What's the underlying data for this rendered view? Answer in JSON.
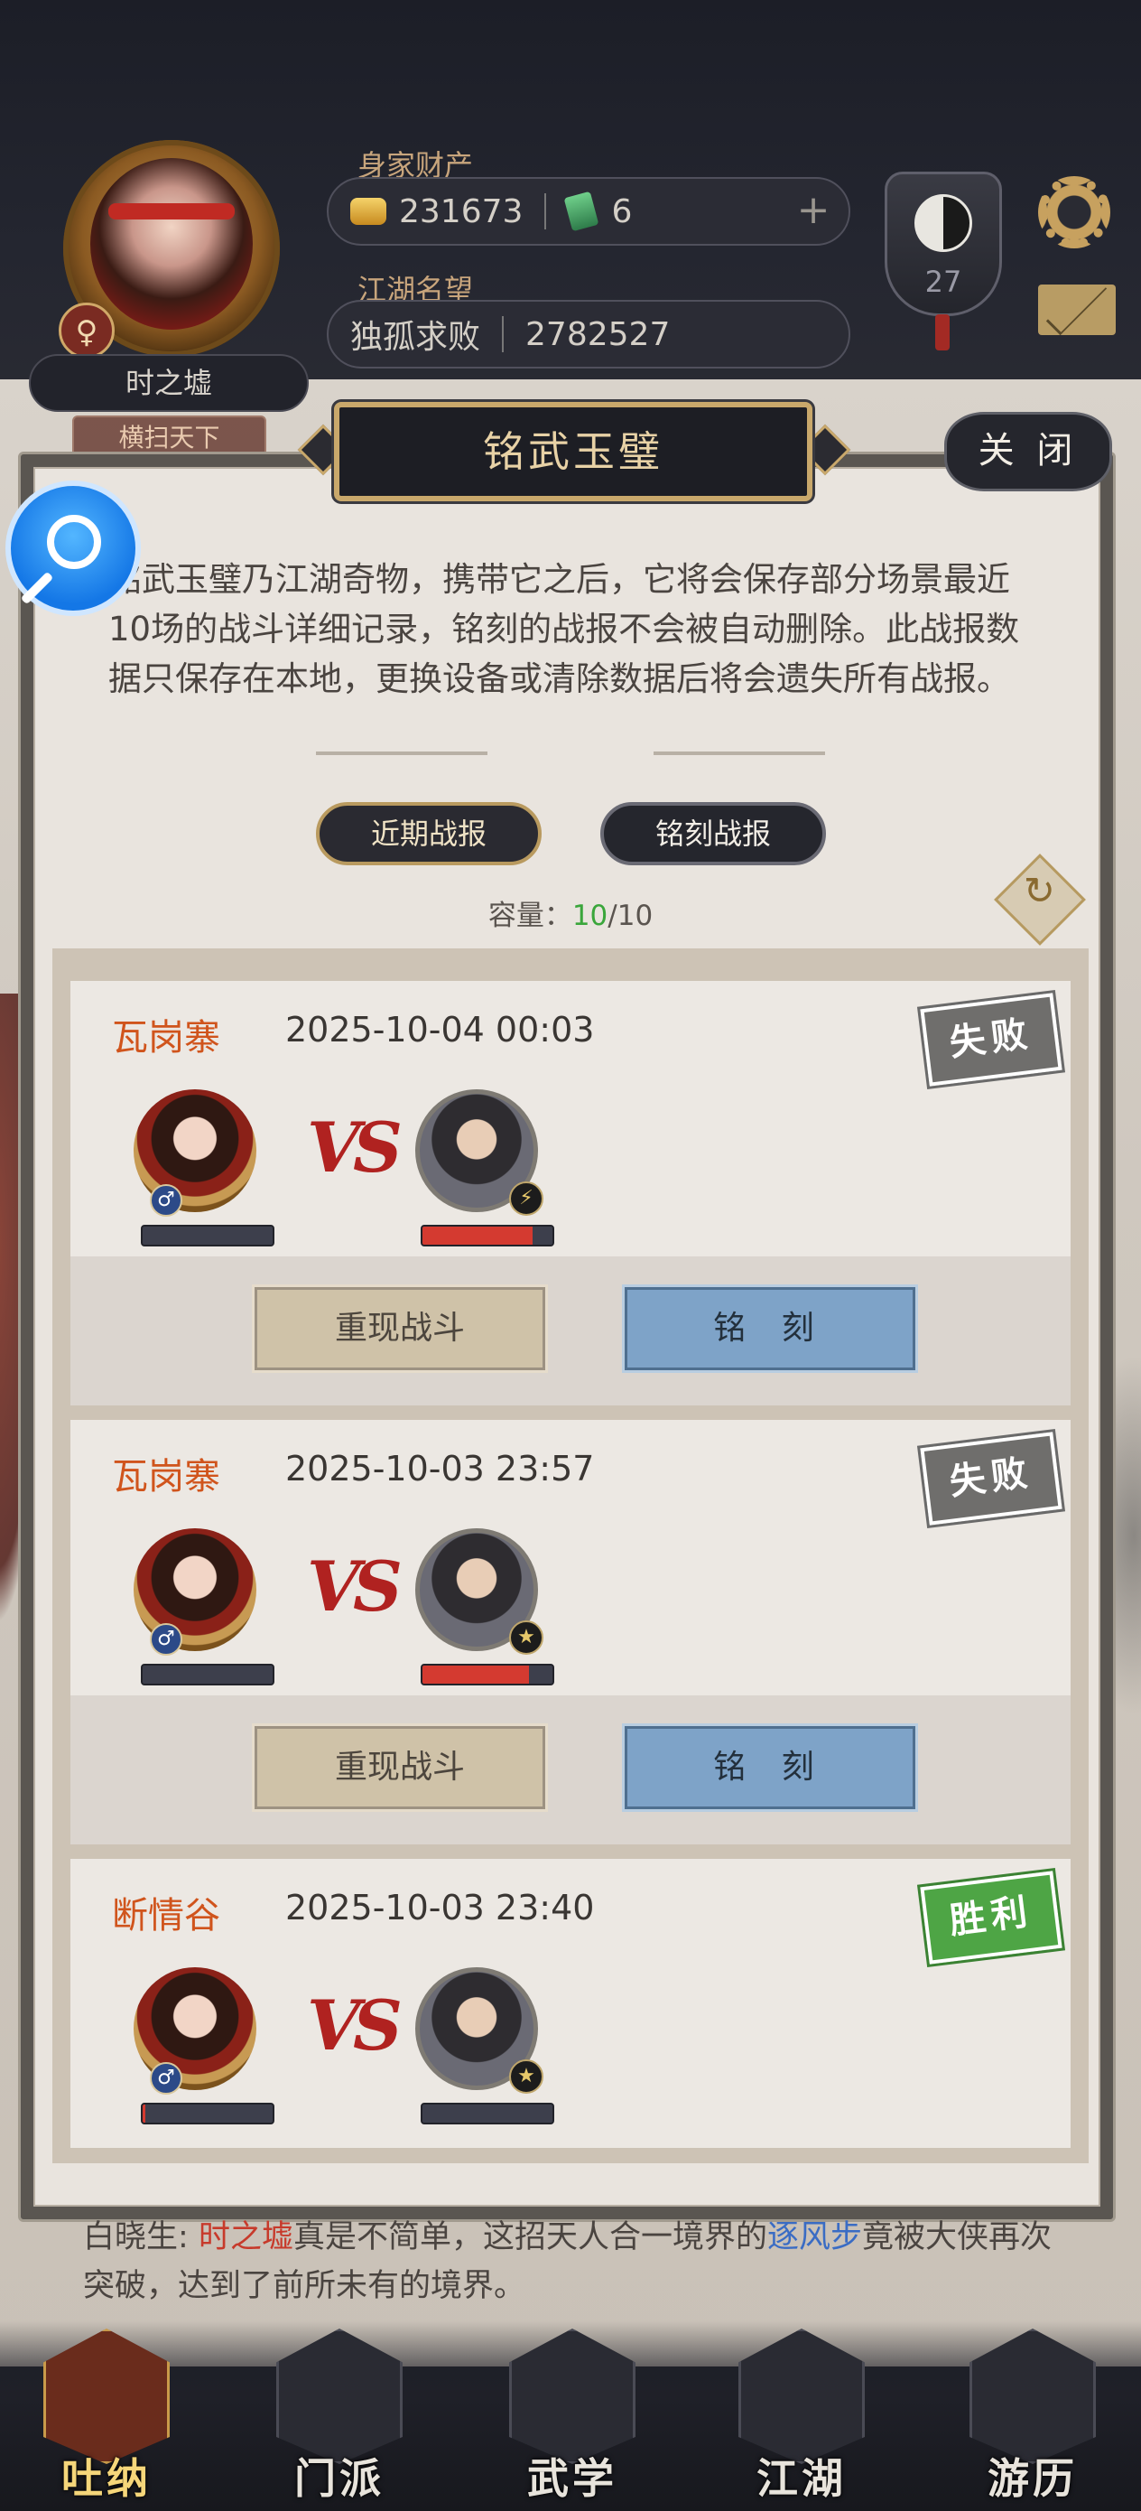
{
  "player": {
    "name": "时之墟",
    "subtitle": "横扫天下",
    "gender_symbol": "♀",
    "wealth_label": "身家财产",
    "gold": "231673",
    "jade": "6",
    "reputation_label": "江湖名望",
    "title": "独孤求败",
    "reputation": "2782527",
    "level": "27"
  },
  "modal": {
    "title": "铭武玉璧",
    "close_label": "关 闭",
    "description": "铭武玉璧乃江湖奇物，携带它之后，它将会保存部分场景最近10场的战斗详细记录，铭刻的战报不会被自动删除。此战报数据只保存在本地，更换设备或清除数据后将会遗失所有战报。",
    "tabs": [
      "近期战报",
      "铭刻战报"
    ],
    "capacity_label": "容量：",
    "capacity_current": "10",
    "capacity_total": "/10"
  },
  "records": [
    {
      "location": "瓦岗寨",
      "time": "2025-10-04 00:03",
      "result": "失败",
      "result_type": "lose",
      "vs": "VS",
      "my_gender": "♂",
      "enemy_badge": "⚡",
      "my_hp": 0,
      "enemy_hp": 0.85,
      "replay_label": "重现战斗",
      "engrave_label": "铭 刻"
    },
    {
      "location": "瓦岗寨",
      "time": "2025-10-03 23:57",
      "result": "失败",
      "result_type": "lose",
      "vs": "VS",
      "my_gender": "♂",
      "enemy_badge": "★",
      "my_hp": 0,
      "enemy_hp": 0.82,
      "replay_label": "重现战斗",
      "engrave_label": "铭 刻"
    },
    {
      "location": "断情谷",
      "time": "2025-10-03 23:40",
      "result": "胜利",
      "result_type": "win",
      "vs": "VS",
      "my_gender": "♂",
      "enemy_badge": "★",
      "my_hp": 0.02,
      "enemy_hp": 0
    }
  ],
  "chat": {
    "speaker": "白晓生:",
    "player_name": "时之墟",
    "text_a": "真是不简单，这招天人合一境界的",
    "skill": "逐风步",
    "text_b": "竟被大侠再次突破，达到了前所未有的境界。"
  },
  "nav": [
    "吐纳",
    "门派",
    "武学",
    "江湖",
    "游历"
  ],
  "colors": {
    "accent_gold": "#c9a86b",
    "lose_gray": "#6f6e6c",
    "win_green": "#4ea545",
    "location_orange": "#d0541c",
    "capacity_green": "#3aa63b"
  }
}
